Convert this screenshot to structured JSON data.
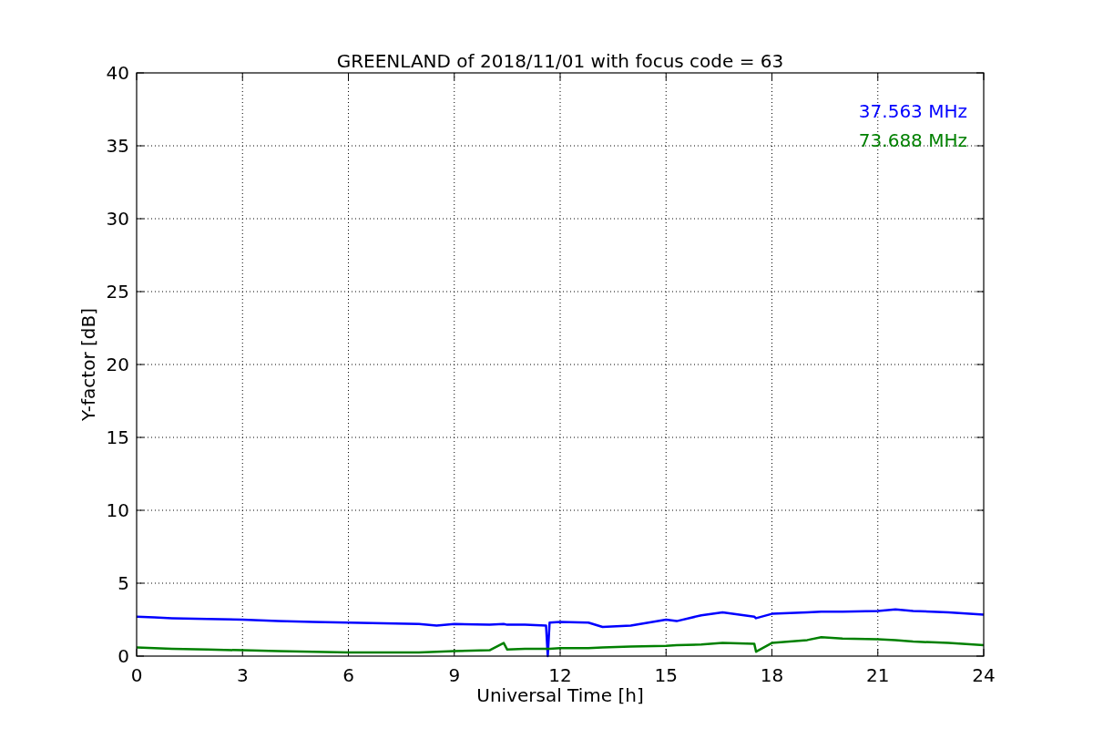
{
  "chart_data": {
    "type": "line",
    "title": "GREENLAND of 2018/11/01 with focus code = 63",
    "xlabel": "Universal Time [h]",
    "ylabel": "Y-factor [dB]",
    "x": [
      0,
      0.5,
      1,
      2,
      3,
      4,
      5,
      6,
      7,
      8,
      8.5,
      9,
      10,
      10.4,
      10.5,
      11,
      11.6,
      11.65,
      11.7,
      12,
      12.8,
      13.2,
      14,
      15,
      15.3,
      16,
      16.6,
      17.5,
      17.55,
      18,
      19,
      19.4,
      20,
      21,
      21.5,
      22,
      23,
      24
    ],
    "series": [
      {
        "name": "37.563 MHz",
        "color": "#0000ff",
        "values": [
          2.7,
          2.65,
          2.6,
          2.55,
          2.5,
          2.4,
          2.35,
          2.3,
          2.25,
          2.2,
          2.1,
          2.2,
          2.15,
          2.2,
          2.15,
          2.15,
          2.1,
          0,
          2.3,
          2.35,
          2.3,
          2.0,
          2.1,
          2.5,
          2.4,
          2.8,
          3.0,
          2.7,
          2.6,
          2.9,
          3.0,
          3.05,
          3.05,
          3.1,
          3.2,
          3.1,
          3.0,
          2.85
        ]
      },
      {
        "name": "73.688 MHz",
        "color": "#008000",
        "values": [
          0.6,
          0.55,
          0.5,
          0.45,
          0.4,
          0.35,
          0.3,
          0.25,
          0.25,
          0.25,
          0.3,
          0.35,
          0.4,
          0.9,
          0.45,
          0.5,
          0.5,
          0.5,
          0.5,
          0.55,
          0.55,
          0.6,
          0.65,
          0.7,
          0.75,
          0.8,
          0.9,
          0.85,
          0.3,
          0.9,
          1.1,
          1.3,
          1.2,
          1.15,
          1.1,
          1.0,
          0.9,
          0.75
        ]
      }
    ],
    "xlim": [
      0,
      24
    ],
    "ylim": [
      0,
      40
    ],
    "xticks": [
      0,
      3,
      6,
      9,
      12,
      15,
      18,
      21,
      24
    ],
    "yticks": [
      0,
      5,
      10,
      15,
      20,
      25,
      30,
      35,
      40
    ],
    "grid": true
  }
}
